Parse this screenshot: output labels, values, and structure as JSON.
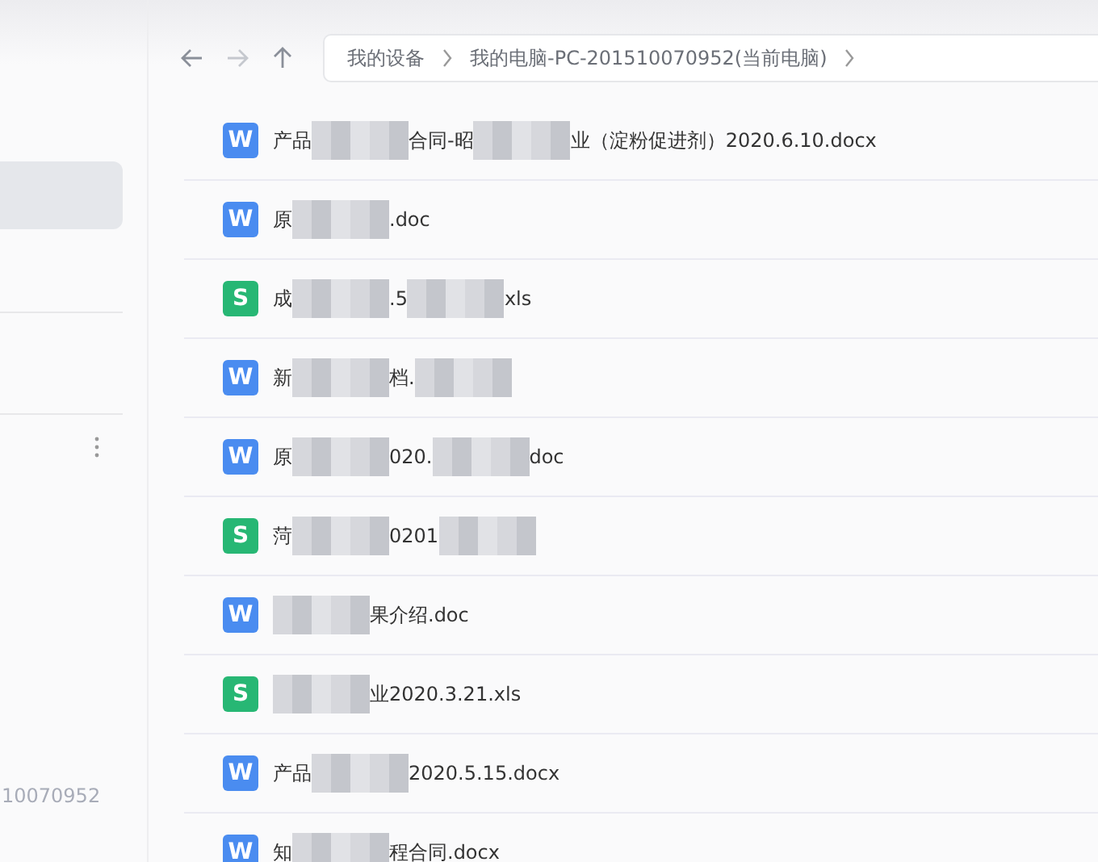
{
  "sidebar": {
    "device_id": "10070952"
  },
  "nav": {
    "buttons": [
      {
        "kind": "back",
        "disabled": false
      },
      {
        "kind": "forward",
        "disabled": true
      },
      {
        "kind": "up",
        "disabled": false
      }
    ]
  },
  "breadcrumb": [
    "我的设备",
    "我的电脑-PC-201510070952(当前电脑)"
  ],
  "files": [
    {
      "type": "W",
      "parts": [
        {
          "kind": "text",
          "text": "产品"
        },
        {
          "kind": "mosaic"
        },
        {
          "kind": "text",
          "text": "合同-昭"
        },
        {
          "kind": "mosaic"
        },
        {
          "kind": "text",
          "text": "业（淀粉促进剂）2020.6.10.docx"
        }
      ]
    },
    {
      "type": "W",
      "parts": [
        {
          "kind": "text",
          "text": "原"
        },
        {
          "kind": "mosaic"
        },
        {
          "kind": "text",
          "text": ".doc"
        }
      ]
    },
    {
      "type": "S",
      "parts": [
        {
          "kind": "text",
          "text": "成"
        },
        {
          "kind": "mosaic"
        },
        {
          "kind": "text",
          "text": ".5"
        },
        {
          "kind": "mosaic"
        },
        {
          "kind": "text",
          "text": "xls"
        }
      ]
    },
    {
      "type": "W",
      "parts": [
        {
          "kind": "text",
          "text": "新"
        },
        {
          "kind": "mosaic"
        },
        {
          "kind": "text",
          "text": "档."
        },
        {
          "kind": "mosaic"
        }
      ]
    },
    {
      "type": "W",
      "parts": [
        {
          "kind": "text",
          "text": "原"
        },
        {
          "kind": "mosaic"
        },
        {
          "kind": "text",
          "text": "020."
        },
        {
          "kind": "mosaic"
        },
        {
          "kind": "text",
          "text": "doc"
        }
      ]
    },
    {
      "type": "S",
      "parts": [
        {
          "kind": "text",
          "text": "菏"
        },
        {
          "kind": "mosaic"
        },
        {
          "kind": "text",
          "text": "0201"
        },
        {
          "kind": "mosaic"
        }
      ]
    },
    {
      "type": "W",
      "parts": [
        {
          "kind": "mosaic"
        },
        {
          "kind": "text",
          "text": "果介绍.doc"
        }
      ]
    },
    {
      "type": "S",
      "parts": [
        {
          "kind": "mosaic"
        },
        {
          "kind": "text",
          "text": "业2020.3.21.xls"
        }
      ]
    },
    {
      "type": "W",
      "parts": [
        {
          "kind": "text",
          "text": "产品"
        },
        {
          "kind": "mosaic"
        },
        {
          "kind": "text",
          "text": "2020.5.15.docx"
        }
      ]
    },
    {
      "type": "W",
      "parts": [
        {
          "kind": "text",
          "text": "知"
        },
        {
          "kind": "mosaic"
        },
        {
          "kind": "text",
          "text": "程合同.docx"
        }
      ]
    }
  ]
}
